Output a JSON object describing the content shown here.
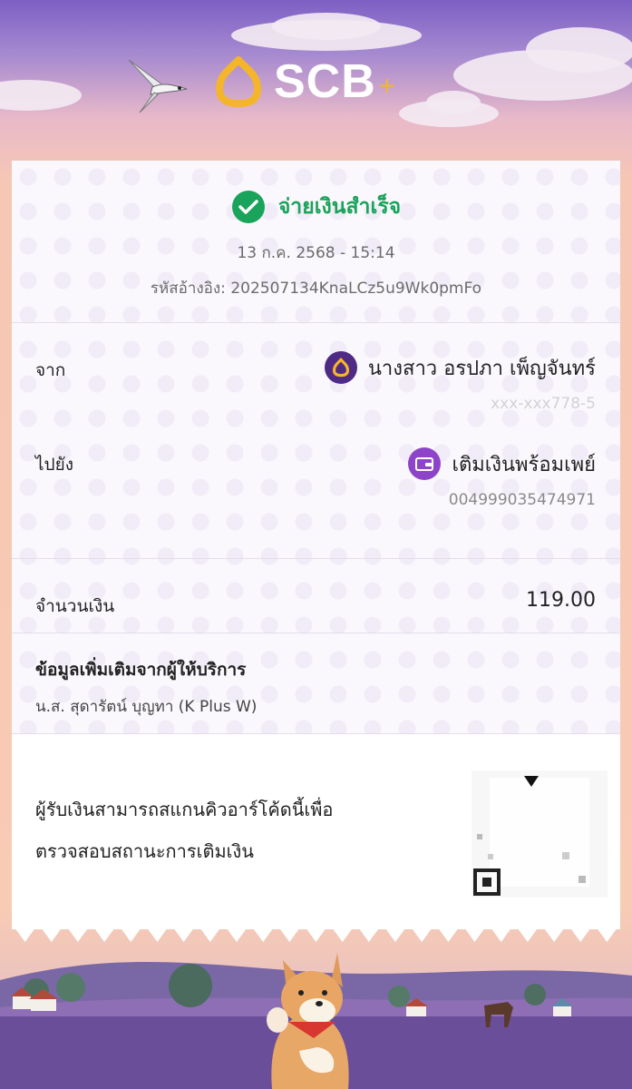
{
  "brand": {
    "name": "SCB",
    "sparkle": "+"
  },
  "status": {
    "text": "จ่ายเงินสำเร็จ",
    "datetime": "13 ก.ค. 2568 - 15:14",
    "reference": "รหัสอ้างอิง: 202507134KnaLCz5u9Wk0pmFo"
  },
  "from": {
    "label": "จาก",
    "name": "นางสาว อรปภา เพ็ญจันทร์",
    "account": "xxx-xxx778-5"
  },
  "to": {
    "label": "ไปยัง",
    "name": "เติมเงินพร้อมเพย์",
    "account": "004999035474971"
  },
  "amount": {
    "label": "จำนวนเงิน",
    "value": "119.00"
  },
  "extra": {
    "title": "ข้อมูลเพิ่มเติมจากผู้ให้บริการ",
    "detail": "น.ส. สุดารัตน์ บุญทา (K Plus W)"
  },
  "qr_note": {
    "line1": "ผู้รับเงินสามารถสแกนคิวอาร์โค้ดนี้เพื่อ",
    "line2": "ตรวจสอบสถานะการเติมเงิน"
  },
  "colors": {
    "success": "#1aa35a",
    "brand_purple": "#4e2a84",
    "brand_gold": "#f5b52a",
    "wallet_purple": "#8e44c9"
  },
  "icons": {
    "status": "check-circle-icon",
    "from_bank": "scb-logo-icon",
    "to_wallet": "wallet-icon"
  }
}
